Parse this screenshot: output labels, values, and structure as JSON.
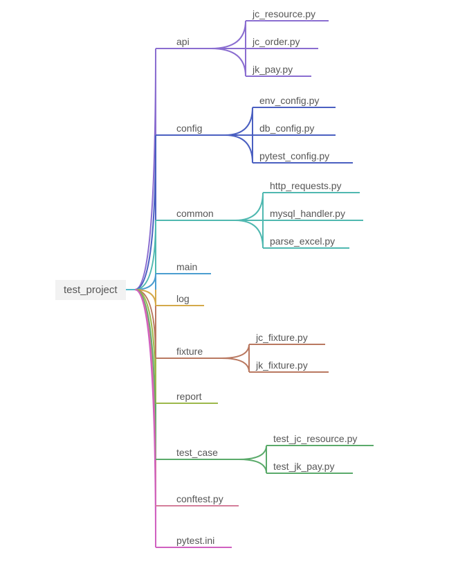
{
  "root": "test_project",
  "branches": {
    "b1": {
      "label": "api",
      "color": "#8a6dd0",
      "children": [
        "jc_resource.py",
        "jc_order.py",
        "jk_pay.py"
      ]
    },
    "b2": {
      "label": "config",
      "color": "#4a5fc1",
      "children": [
        "env_config.py",
        "db_config.py",
        "pytest_config.py"
      ]
    },
    "b3": {
      "label": "common",
      "color": "#4fb8b0",
      "children": [
        "http_requests.py",
        "mysql_handler.py",
        "parse_excel.py"
      ]
    },
    "b4": {
      "label": "main",
      "color": "#4a9dd0",
      "children": []
    },
    "b5": {
      "label": "log",
      "color": "#d4a94a",
      "children": []
    },
    "b6": {
      "label": "fixture",
      "color": "#b97860",
      "children": [
        "jc_fixture.py",
        "jk_fixture.py"
      ]
    },
    "b7": {
      "label": "report",
      "color": "#9cb84a",
      "children": []
    },
    "b8": {
      "label": "test_case",
      "color": "#5aaa6a",
      "children": [
        "test_jc_resource.py",
        "test_jk_pay.py"
      ]
    },
    "b9": {
      "label": "conftest.py",
      "color": "#d47d9a",
      "children": []
    },
    "b10": {
      "label": "pytest.ini",
      "color": "#d060c0",
      "children": []
    }
  }
}
